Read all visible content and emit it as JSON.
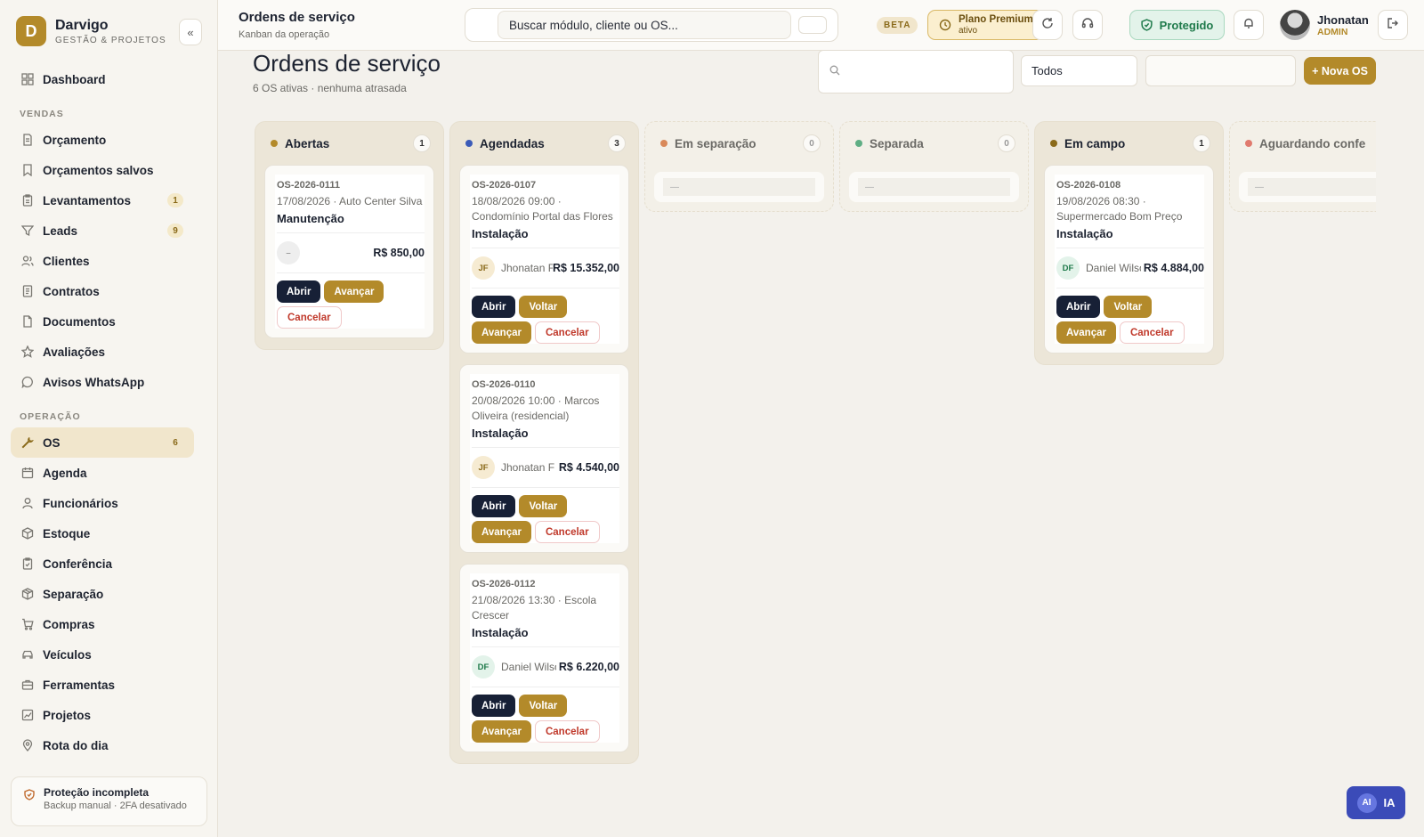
{
  "brand": {
    "logo_letter": "D",
    "name": "Darvigo",
    "subtitle": "GESTÃO & PROJETOS"
  },
  "sidebar": {
    "collapse_label": "«",
    "top_items": [
      {
        "label": "Dashboard",
        "icon": "grid-icon"
      }
    ],
    "section_vendas": "VENDAS",
    "vendas_items": [
      {
        "label": "Orçamento",
        "icon": "file-icon",
        "badge": ""
      },
      {
        "label": "Orçamentos salvos",
        "icon": "bookmark-icon",
        "badge": ""
      },
      {
        "label": "Levantamentos",
        "icon": "clipboard-icon",
        "badge": "1"
      },
      {
        "label": "Leads",
        "icon": "filter-icon",
        "badge": "9"
      },
      {
        "label": "Clientes",
        "icon": "users-icon",
        "badge": ""
      },
      {
        "label": "Contratos",
        "icon": "document-icon",
        "badge": ""
      },
      {
        "label": "Documentos",
        "icon": "page-icon",
        "badge": ""
      },
      {
        "label": "Avaliações",
        "icon": "star-icon",
        "badge": ""
      },
      {
        "label": "Avisos WhatsApp",
        "icon": "chat-icon",
        "badge": ""
      }
    ],
    "section_operacao": "OPERAÇÃO",
    "operacao_items": [
      {
        "label": "OS",
        "icon": "wrench-icon",
        "badge": "6",
        "active": true
      },
      {
        "label": "Agenda",
        "icon": "calendar-icon",
        "badge": ""
      },
      {
        "label": "Funcionários",
        "icon": "user-icon",
        "badge": ""
      },
      {
        "label": "Estoque",
        "icon": "box-icon",
        "badge": ""
      },
      {
        "label": "Conferência",
        "icon": "clipboard-check-icon",
        "badge": ""
      },
      {
        "label": "Separação",
        "icon": "package-icon",
        "badge": ""
      },
      {
        "label": "Compras",
        "icon": "cart-icon",
        "badge": ""
      },
      {
        "label": "Veículos",
        "icon": "car-icon",
        "badge": ""
      },
      {
        "label": "Ferramentas",
        "icon": "toolbox-icon",
        "badge": ""
      },
      {
        "label": "Projetos",
        "icon": "chart-icon",
        "badge": ""
      },
      {
        "label": "Rota do dia",
        "icon": "pin-icon",
        "badge": ""
      }
    ],
    "protection": {
      "title": "Proteção incompleta",
      "subtitle": "Backup manual · 2FA desativado"
    }
  },
  "topbar": {
    "title": "Ordens de serviço",
    "subtitle": "Kanban da operação",
    "search_placeholder": "Buscar módulo, cliente ou OS...",
    "beta_label": "BETA",
    "plan_name": "Plano Premium",
    "plan_state": "ativo",
    "protected_label": "Protegido",
    "user_name": "Jhonatan",
    "user_role": "ADMIN"
  },
  "main": {
    "title": "Ordens de serviço",
    "subtitle": "6 OS ativas · nenhuma atrasada",
    "filter_select_value": "Todos",
    "new_button": "+ Nova OS"
  },
  "columns": [
    {
      "title": "Abertas",
      "count": "1",
      "color": "#b38a2a",
      "cards": [
        {
          "id": "OS-2026-0111",
          "meta": "17/08/2026 · Auto Center Silva",
          "type": "Manutenção",
          "initials": "–",
          "assignee": "",
          "amount": "R$ 850,00",
          "actions": [
            "Abrir",
            "Avançar",
            "Cancelar"
          ]
        }
      ]
    },
    {
      "title": "Agendadas",
      "count": "3",
      "color": "#3b5bb8",
      "cards": [
        {
          "id": "OS-2026-0107",
          "meta": "18/08/2026 09:00 · Condomínio Portal das Flores",
          "type": "Instalação",
          "initials": "JF",
          "assignee": "Jhonatan F",
          "amount": "R$ 15.352,00",
          "actions": [
            "Abrir",
            "Voltar",
            "Avançar",
            "Cancelar"
          ]
        },
        {
          "id": "OS-2026-0110",
          "meta": "20/08/2026 10:00 · Marcos Oliveira (residencial)",
          "type": "Instalação",
          "initials": "JF",
          "assignee": "Jhonatan F",
          "amount": "R$ 4.540,00",
          "actions": [
            "Abrir",
            "Voltar",
            "Avançar",
            "Cancelar"
          ]
        },
        {
          "id": "OS-2026-0112",
          "meta": "21/08/2026 13:30 · Escola Crescer",
          "type": "Instalação",
          "initials": "DF",
          "assignee": "Daniel Wilson",
          "amount": "R$ 6.220,00",
          "actions": [
            "Abrir",
            "Voltar",
            "Avançar",
            "Cancelar"
          ]
        }
      ]
    },
    {
      "title": "Em separação",
      "count": "0",
      "color": "#d9895a",
      "placeholder": "—",
      "cards": []
    },
    {
      "title": "Separada",
      "count": "0",
      "color": "#5fae84",
      "placeholder": "—",
      "cards": []
    },
    {
      "title": "Em campo",
      "count": "1",
      "color": "#8a6a1a",
      "cards": [
        {
          "id": "OS-2026-0108",
          "meta": "19/08/2026 08:30 · Supermercado Bom Preço",
          "type": "Instalação",
          "initials": "DF",
          "assignee": "Daniel Wilson",
          "amount": "R$ 4.884,00",
          "actions": [
            "Abrir",
            "Voltar",
            "Avançar",
            "Cancelar"
          ]
        }
      ]
    },
    {
      "title": "Aguardando confe",
      "count": "",
      "color": "#e07a6e",
      "placeholder": "—",
      "cards": []
    }
  ],
  "ai_button": {
    "chip": "AI",
    "label": "IA"
  }
}
